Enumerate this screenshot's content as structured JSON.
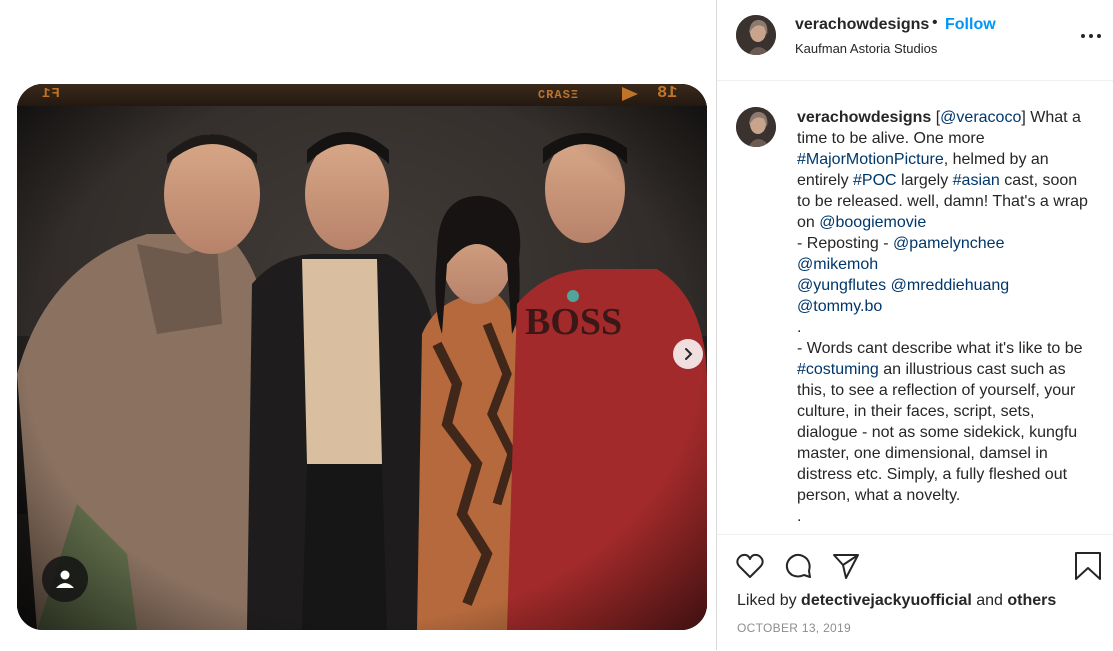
{
  "post": {
    "username": "verachowdesigns",
    "dot": "•",
    "follow_label": "Follow",
    "location": "Kaufman Astoria Studios",
    "menu_icon": "more-horizontal-icon"
  },
  "photo": {
    "film_left": "F1",
    "film_mid": "ΞƧAЯƆ",
    "film_num": "18",
    "next_icon": "chevron-right-icon",
    "tag_icon": "user-tag-icon"
  },
  "caption": {
    "username": "verachowdesigns",
    "p1": " [",
    "m_veracoco": "@veracoco",
    "p2": "] What a time to be alive. One more ",
    "h_major": "#MajorMotionPicture",
    "p3": ", helmed by an entirely ",
    "h_poc": "#POC",
    "p4": " largely ",
    "h_asian": "#asian",
    "p5": " cast, soon to be released. well, damn! That's a wrap on ",
    "m_boogie": "@boogiemovie",
    "p6": "- Reposting - ",
    "m_pamela": "@pamelynchee",
    "m_mike": "@mikemoh",
    "m_yung": "@yungflutes",
    "m_eddie": "@mreddiehuang",
    "m_tommy": "@tommy.bo",
    "dot1": ".",
    "p7": "- Words cant describe what it's like to be ",
    "h_costuming": "#costuming",
    "p8": " an illustrious cast such as this, to see a reflection of yourself, your culture, in their faces, script, sets, dialogue - not as some sidekick, kungfu master, one dimensional, damsel in distress etc. Simply, a fully fleshed out person, what a novelty.",
    "dot2": "."
  },
  "actions": {
    "like_icon": "heart-icon",
    "comment_icon": "comment-icon",
    "share_icon": "send-icon",
    "save_icon": "bookmark-icon",
    "liked_prefix": "Liked by ",
    "liked_user": "detectivejackyuofficial",
    "liked_and": " and ",
    "liked_others": "others",
    "date": "OCTOBER 13, 2019"
  }
}
